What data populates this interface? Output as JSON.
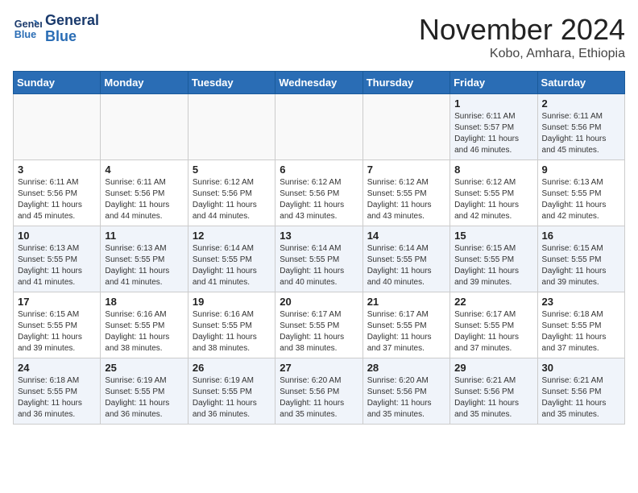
{
  "logo": {
    "line1": "General",
    "line2": "Blue"
  },
  "title": "November 2024",
  "location": "Kobo, Amhara, Ethiopia",
  "weekdays": [
    "Sunday",
    "Monday",
    "Tuesday",
    "Wednesday",
    "Thursday",
    "Friday",
    "Saturday"
  ],
  "weeks": [
    [
      {
        "day": "",
        "detail": ""
      },
      {
        "day": "",
        "detail": ""
      },
      {
        "day": "",
        "detail": ""
      },
      {
        "day": "",
        "detail": ""
      },
      {
        "day": "",
        "detail": ""
      },
      {
        "day": "1",
        "detail": "Sunrise: 6:11 AM\nSunset: 5:57 PM\nDaylight: 11 hours\nand 46 minutes."
      },
      {
        "day": "2",
        "detail": "Sunrise: 6:11 AM\nSunset: 5:56 PM\nDaylight: 11 hours\nand 45 minutes."
      }
    ],
    [
      {
        "day": "3",
        "detail": "Sunrise: 6:11 AM\nSunset: 5:56 PM\nDaylight: 11 hours\nand 45 minutes."
      },
      {
        "day": "4",
        "detail": "Sunrise: 6:11 AM\nSunset: 5:56 PM\nDaylight: 11 hours\nand 44 minutes."
      },
      {
        "day": "5",
        "detail": "Sunrise: 6:12 AM\nSunset: 5:56 PM\nDaylight: 11 hours\nand 44 minutes."
      },
      {
        "day": "6",
        "detail": "Sunrise: 6:12 AM\nSunset: 5:56 PM\nDaylight: 11 hours\nand 43 minutes."
      },
      {
        "day": "7",
        "detail": "Sunrise: 6:12 AM\nSunset: 5:55 PM\nDaylight: 11 hours\nand 43 minutes."
      },
      {
        "day": "8",
        "detail": "Sunrise: 6:12 AM\nSunset: 5:55 PM\nDaylight: 11 hours\nand 42 minutes."
      },
      {
        "day": "9",
        "detail": "Sunrise: 6:13 AM\nSunset: 5:55 PM\nDaylight: 11 hours\nand 42 minutes."
      }
    ],
    [
      {
        "day": "10",
        "detail": "Sunrise: 6:13 AM\nSunset: 5:55 PM\nDaylight: 11 hours\nand 41 minutes."
      },
      {
        "day": "11",
        "detail": "Sunrise: 6:13 AM\nSunset: 5:55 PM\nDaylight: 11 hours\nand 41 minutes."
      },
      {
        "day": "12",
        "detail": "Sunrise: 6:14 AM\nSunset: 5:55 PM\nDaylight: 11 hours\nand 41 minutes."
      },
      {
        "day": "13",
        "detail": "Sunrise: 6:14 AM\nSunset: 5:55 PM\nDaylight: 11 hours\nand 40 minutes."
      },
      {
        "day": "14",
        "detail": "Sunrise: 6:14 AM\nSunset: 5:55 PM\nDaylight: 11 hours\nand 40 minutes."
      },
      {
        "day": "15",
        "detail": "Sunrise: 6:15 AM\nSunset: 5:55 PM\nDaylight: 11 hours\nand 39 minutes."
      },
      {
        "day": "16",
        "detail": "Sunrise: 6:15 AM\nSunset: 5:55 PM\nDaylight: 11 hours\nand 39 minutes."
      }
    ],
    [
      {
        "day": "17",
        "detail": "Sunrise: 6:15 AM\nSunset: 5:55 PM\nDaylight: 11 hours\nand 39 minutes."
      },
      {
        "day": "18",
        "detail": "Sunrise: 6:16 AM\nSunset: 5:55 PM\nDaylight: 11 hours\nand 38 minutes."
      },
      {
        "day": "19",
        "detail": "Sunrise: 6:16 AM\nSunset: 5:55 PM\nDaylight: 11 hours\nand 38 minutes."
      },
      {
        "day": "20",
        "detail": "Sunrise: 6:17 AM\nSunset: 5:55 PM\nDaylight: 11 hours\nand 38 minutes."
      },
      {
        "day": "21",
        "detail": "Sunrise: 6:17 AM\nSunset: 5:55 PM\nDaylight: 11 hours\nand 37 minutes."
      },
      {
        "day": "22",
        "detail": "Sunrise: 6:17 AM\nSunset: 5:55 PM\nDaylight: 11 hours\nand 37 minutes."
      },
      {
        "day": "23",
        "detail": "Sunrise: 6:18 AM\nSunset: 5:55 PM\nDaylight: 11 hours\nand 37 minutes."
      }
    ],
    [
      {
        "day": "24",
        "detail": "Sunrise: 6:18 AM\nSunset: 5:55 PM\nDaylight: 11 hours\nand 36 minutes."
      },
      {
        "day": "25",
        "detail": "Sunrise: 6:19 AM\nSunset: 5:55 PM\nDaylight: 11 hours\nand 36 minutes."
      },
      {
        "day": "26",
        "detail": "Sunrise: 6:19 AM\nSunset: 5:55 PM\nDaylight: 11 hours\nand 36 minutes."
      },
      {
        "day": "27",
        "detail": "Sunrise: 6:20 AM\nSunset: 5:56 PM\nDaylight: 11 hours\nand 35 minutes."
      },
      {
        "day": "28",
        "detail": "Sunrise: 6:20 AM\nSunset: 5:56 PM\nDaylight: 11 hours\nand 35 minutes."
      },
      {
        "day": "29",
        "detail": "Sunrise: 6:21 AM\nSunset: 5:56 PM\nDaylight: 11 hours\nand 35 minutes."
      },
      {
        "day": "30",
        "detail": "Sunrise: 6:21 AM\nSunset: 5:56 PM\nDaylight: 11 hours\nand 35 minutes."
      }
    ]
  ]
}
